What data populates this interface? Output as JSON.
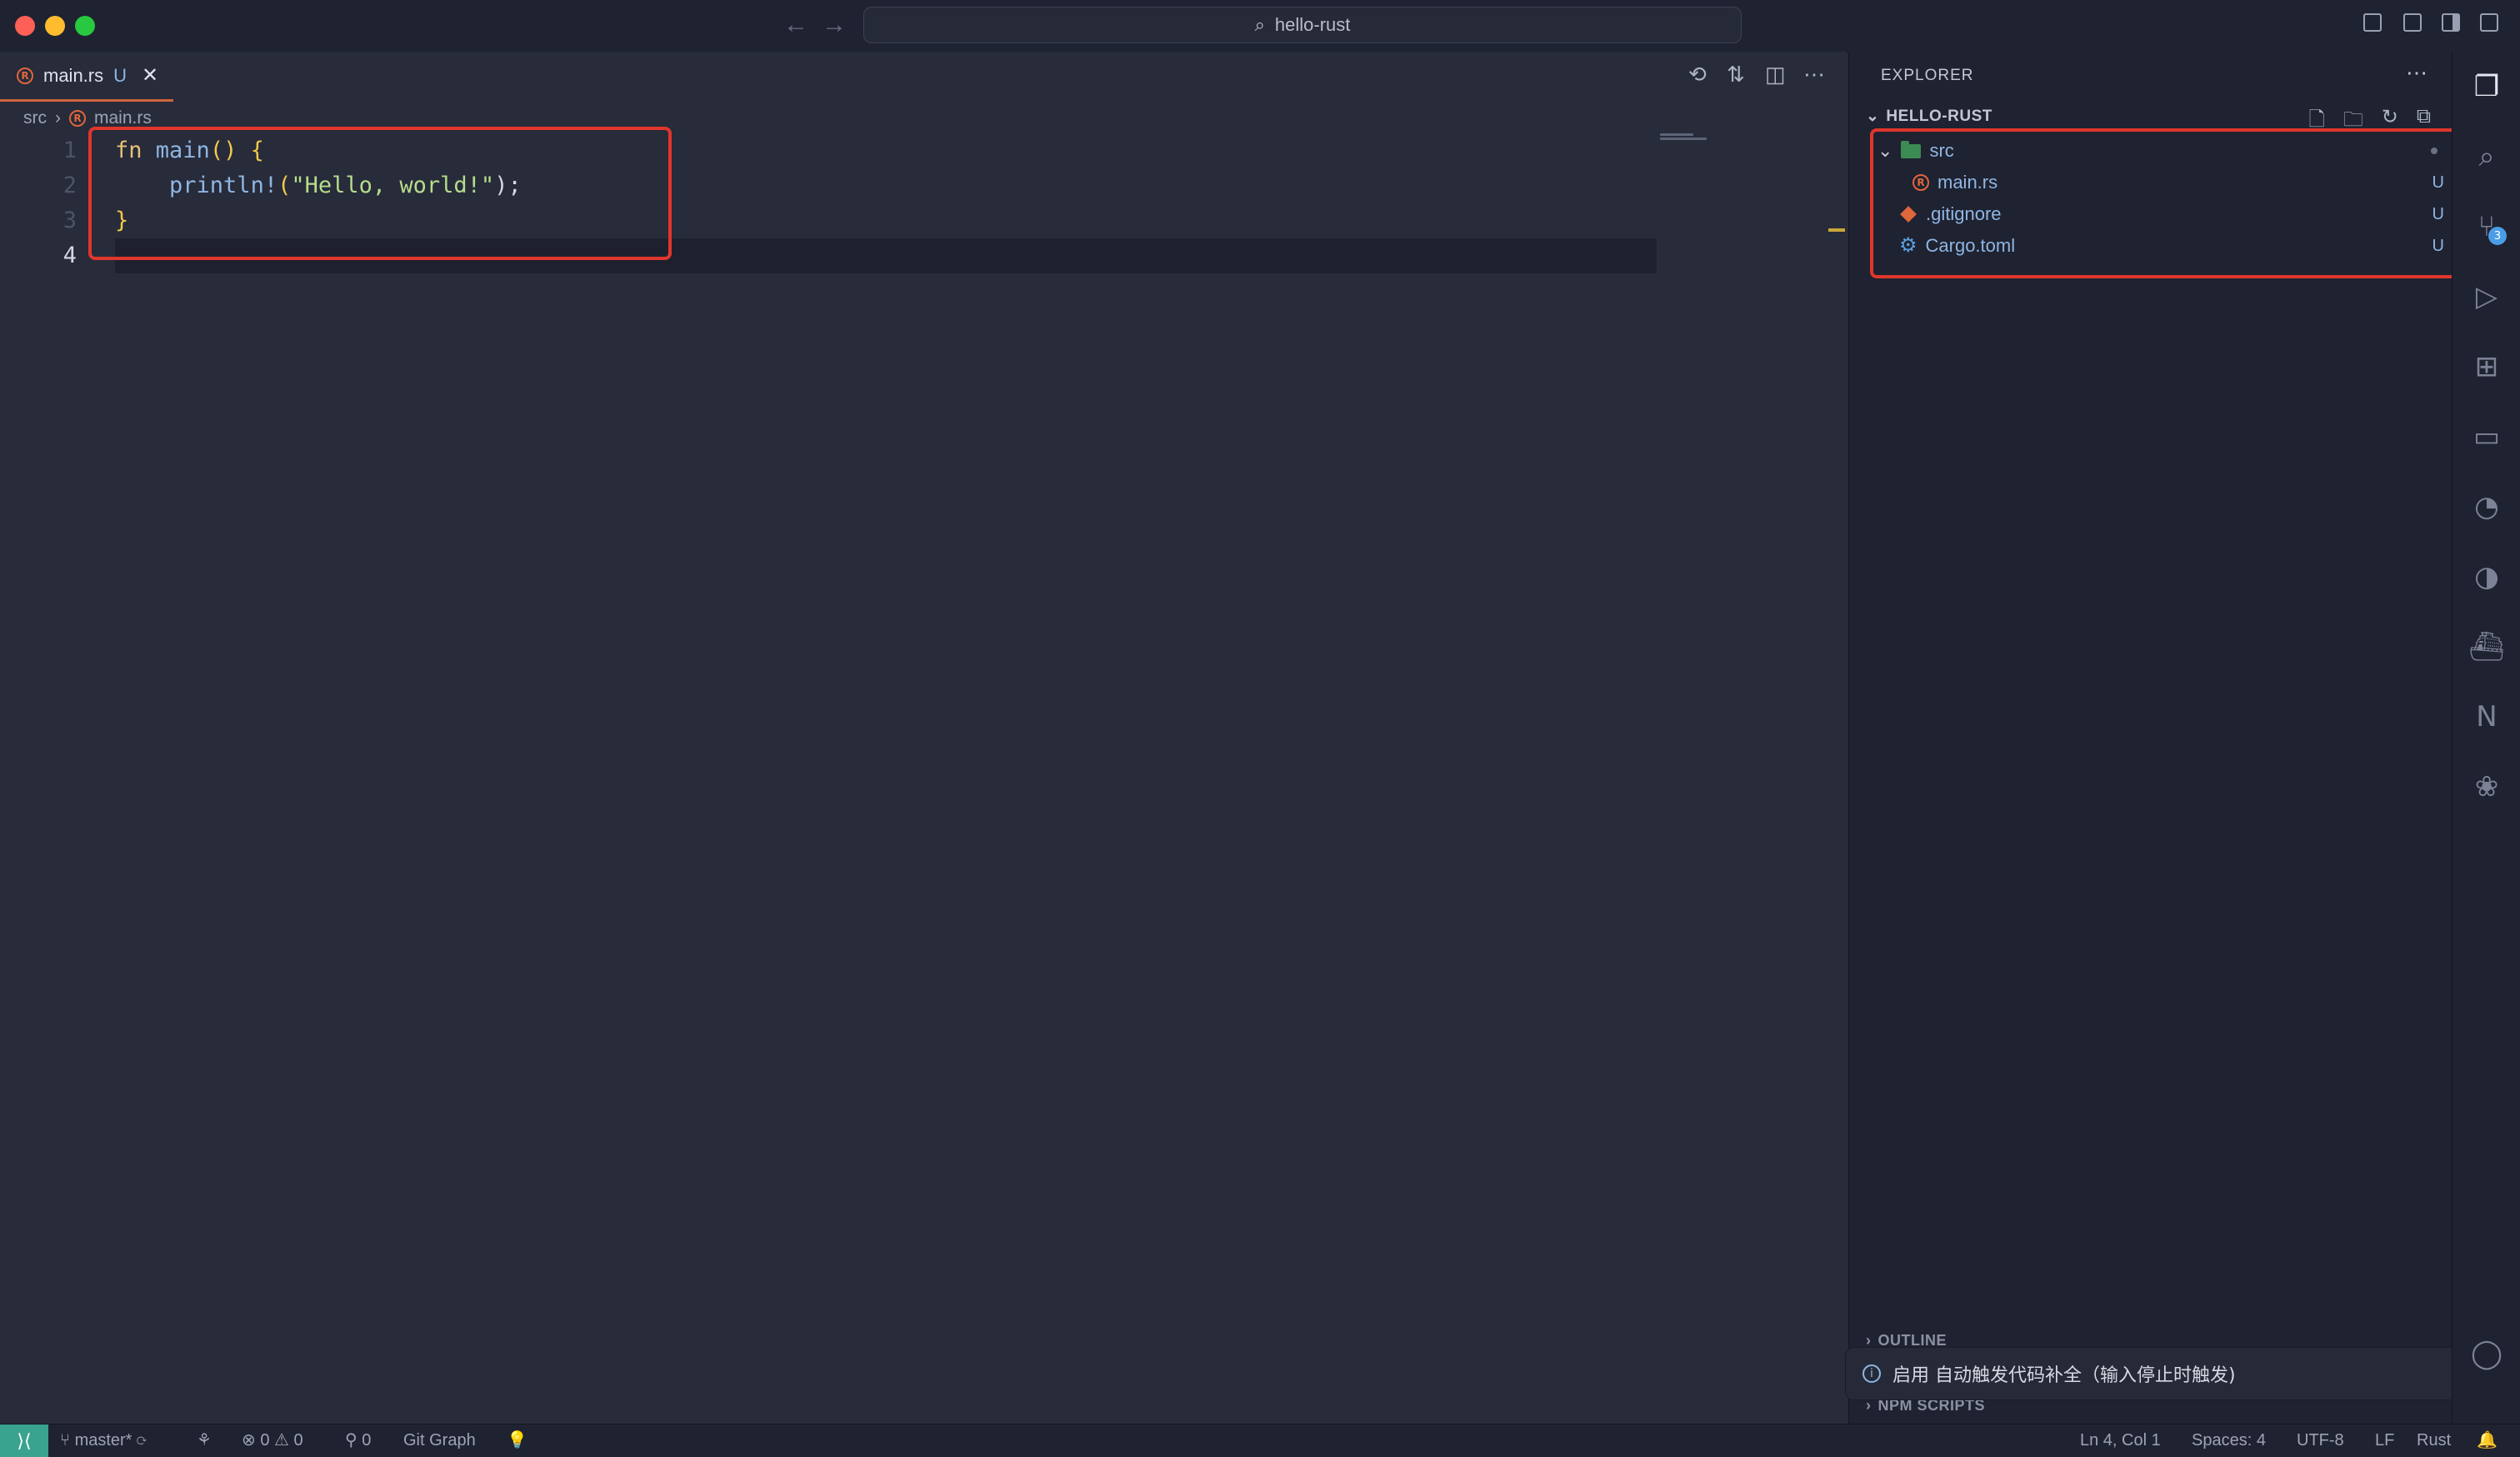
{
  "title_bar": {
    "search_text": "hello-rust"
  },
  "editor": {
    "tab_label": "main.rs",
    "tab_status": "U",
    "breadcrumb": [
      "src",
      "main.rs"
    ],
    "line_numbers": [
      "1",
      "2",
      "3",
      "4"
    ],
    "code": {
      "l1_kw": "fn",
      "l1_name": "main",
      "l1_rest": "() {",
      "l2_indent": "    ",
      "l2_macro": "println!",
      "l2_open": "(",
      "l2_str": "\"Hello, world!\"",
      "l2_close": ");",
      "l3": "}"
    }
  },
  "explorer": {
    "title": "EXPLORER",
    "root": "HELLO-RUST",
    "items": [
      {
        "name": "src",
        "badge": ""
      },
      {
        "name": "main.rs",
        "badge": "U"
      },
      {
        "name": ".gitignore",
        "badge": "U"
      },
      {
        "name": "Cargo.toml",
        "badge": "U"
      }
    ],
    "outline": "OUTLINE",
    "npm": "NPM SCRIPTS"
  },
  "notification": {
    "text": "启用 自动触发代码补全（输入停止时触发)"
  },
  "activity_bar": {
    "source_control_badge": "3"
  },
  "status_bar": {
    "branch": "master*",
    "errors": "0",
    "warnings": "0",
    "ports": "0",
    "git_graph": "Git Graph",
    "position": "Ln 4, Col 1",
    "spaces": "Spaces: 4",
    "encoding": "UTF-8",
    "eol": "LF",
    "language": "Rust"
  },
  "colors": {
    "highlight": "#e0362c",
    "rust_orange": "#e0663b",
    "accent_blue": "#8fb6e3"
  }
}
